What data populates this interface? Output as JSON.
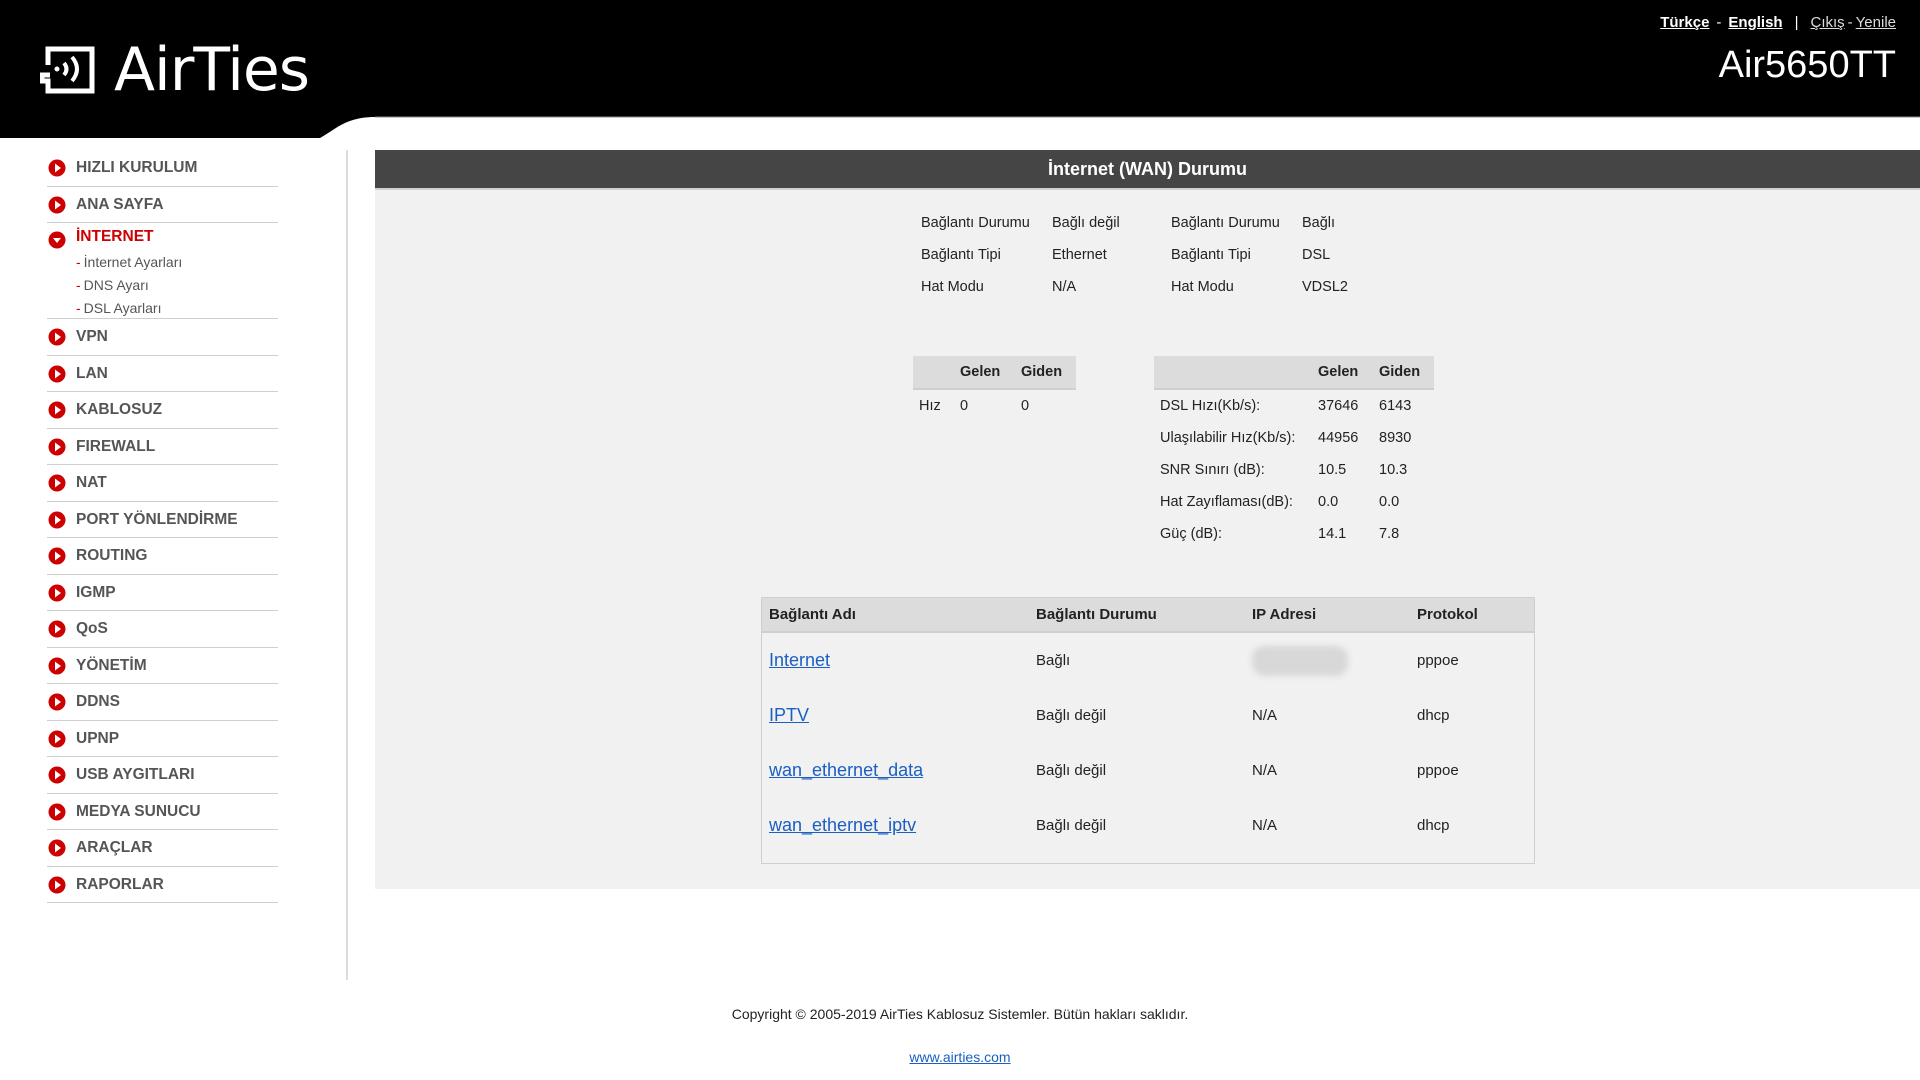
{
  "header": {
    "brand": "AirTies",
    "model": "Air5650TT",
    "links": [
      {
        "label": "Türkçe"
      },
      {
        "label": "English"
      },
      {
        "label": "Çıkış"
      },
      {
        "label": "Yenile"
      }
    ],
    "separators": {
      "dash": "-",
      "pipe": "|"
    }
  },
  "sidebar": {
    "items": [
      {
        "label": "HIZLI KURULUM"
      },
      {
        "label": "ANA SAYFA"
      },
      {
        "label": "İNTERNET",
        "expanded": true,
        "subitems": [
          "İnternet Ayarları",
          "DNS Ayarı",
          "DSL Ayarları"
        ]
      },
      {
        "label": "VPN"
      },
      {
        "label": "LAN"
      },
      {
        "label": "KABLOSUZ"
      },
      {
        "label": "FIREWALL"
      },
      {
        "label": "NAT"
      },
      {
        "label": "PORT YÖNLENDİRME"
      },
      {
        "label": "ROUTING"
      },
      {
        "label": "IGMP"
      },
      {
        "label": "QoS"
      },
      {
        "label": "YÖNETİM"
      },
      {
        "label": "DDNS"
      },
      {
        "label": "UPNP"
      },
      {
        "label": "USB AYGITLARI"
      },
      {
        "label": "MEDYA SUNUCU"
      },
      {
        "label": "ARAÇLAR"
      },
      {
        "label": "RAPORLAR"
      }
    ],
    "sub_dash": "-"
  },
  "main": {
    "title": "İnternet (WAN) Durumu",
    "ethernet_status": [
      {
        "label": "Bağlantı Durumu",
        "value": "Bağlı değil"
      },
      {
        "label": "Bağlantı Tipi",
        "value": "Ethernet"
      },
      {
        "label": "Hat Modu",
        "value": "N/A"
      }
    ],
    "dsl_status": [
      {
        "label": "Bağlantı Durumu",
        "value": "Bağlı"
      },
      {
        "label": "Bağlantı Tipi",
        "value": "DSL"
      },
      {
        "label": "Hat Modu",
        "value": "VDSL2"
      }
    ],
    "speed_table": {
      "headers": [
        "",
        "Gelen",
        "Giden"
      ],
      "rows": [
        {
          "label": "Hız",
          "in": "0",
          "out": "0"
        }
      ]
    },
    "dsl_table": {
      "headers": [
        "",
        "Gelen",
        "Giden"
      ],
      "rows": [
        {
          "label": "DSL Hızı(Kb/s):",
          "in": "37646",
          "out": "6143"
        },
        {
          "label": "Ulaşılabilir Hız(Kb/s):",
          "in": "44956",
          "out": "8930"
        },
        {
          "label": "SNR Sınırı (dB):",
          "in": "10.5",
          "out": "10.3"
        },
        {
          "label": "Hat Zayıflaması(dB):",
          "in": "0.0",
          "out": "0.0"
        },
        {
          "label": "Güç (dB):",
          "in": "14.1",
          "out": "7.8"
        }
      ]
    },
    "connections": {
      "headers": [
        "Bağlantı Adı",
        "Bağlantı Durumu",
        "IP Adresi",
        "Protokol"
      ],
      "rows": [
        {
          "name": "Internet",
          "status": "Bağlı",
          "ip": "",
          "ip_redacted": true,
          "protocol": "pppoe"
        },
        {
          "name": "IPTV",
          "status": "Bağlı değil",
          "ip": "N/A",
          "protocol": "dhcp"
        },
        {
          "name": "wan_ethernet_data",
          "status": "Bağlı değil",
          "ip": "N/A",
          "protocol": "pppoe"
        },
        {
          "name": "wan_ethernet_iptv",
          "status": "Bağlı değil",
          "ip": "N/A",
          "protocol": "dhcp"
        }
      ]
    }
  },
  "footer": {
    "copyright": "Copyright © 2005-2019 AirTies Kablosuz Sistemler. Bütün hakları saklıdır.",
    "link": "www.airties.com"
  },
  "colors": {
    "accent": "#cc0000",
    "header_bg": "#000000",
    "panel_head": "#454545",
    "panel_bg": "#f1f1f1",
    "link": "#1a5fc1"
  }
}
